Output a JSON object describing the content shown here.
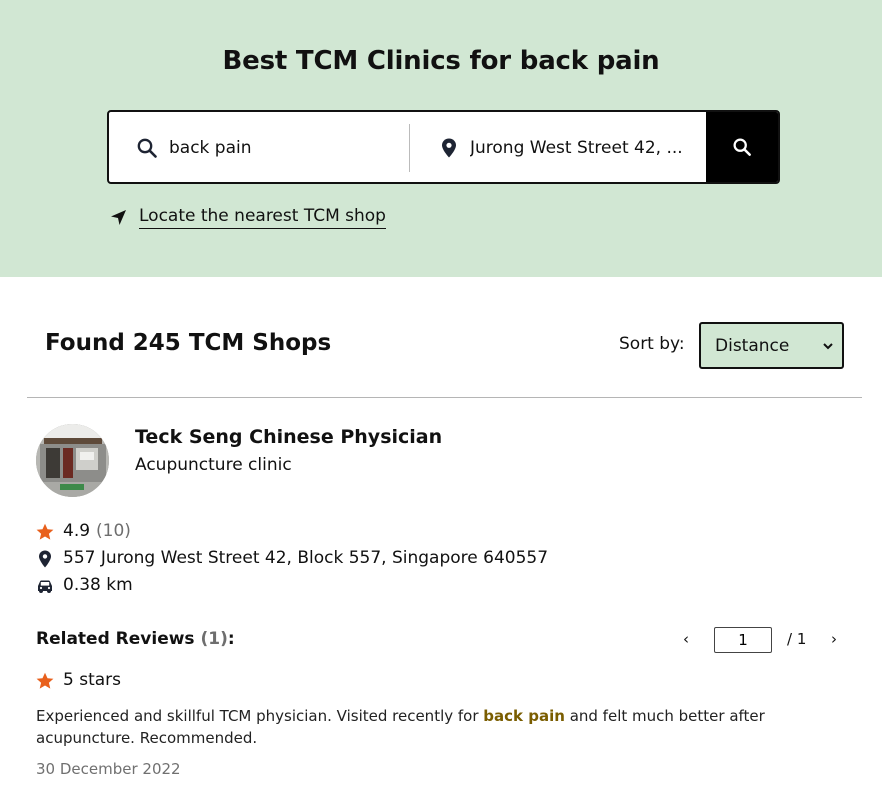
{
  "hero": {
    "title": "Best TCM Clinics for back pain",
    "search_value": "back pain",
    "location_value": "Jurong West Street 42, ...",
    "locate_link": "Locate the nearest TCM shop"
  },
  "results": {
    "found_text": "Found 245 TCM Shops",
    "sort_label": "Sort by:",
    "sort_value": "Distance"
  },
  "shop": {
    "name": "Teck Seng Chinese Physician",
    "type": "Acupuncture clinic",
    "rating": "4.9",
    "rating_count": "(10)",
    "address": "557 Jurong West Street 42, Block 557, Singapore 640557",
    "distance": "0.38 km"
  },
  "reviews": {
    "heading": "Related Reviews",
    "count": "(1)",
    "colon": ":",
    "pager": {
      "prev": "‹",
      "current": "1",
      "total": "/ 1",
      "next": "›"
    },
    "items": [
      {
        "stars": "5 stars",
        "text_before": "Experienced and skillful TCM physician. Visited recently for ",
        "highlight": "back pain",
        "text_after": " and felt much better after acupuncture. Recommended.",
        "date": "30 December 2022"
      }
    ]
  },
  "colors": {
    "hero_bg": "#d1e7d3",
    "star": "#e8601c",
    "highlight": "#7a5d00",
    "muted": "#6e6e6e"
  },
  "icons": [
    "search-icon",
    "location-pin-icon",
    "navigation-arrow-icon",
    "chevron-down-icon",
    "star-icon",
    "car-icon"
  ]
}
